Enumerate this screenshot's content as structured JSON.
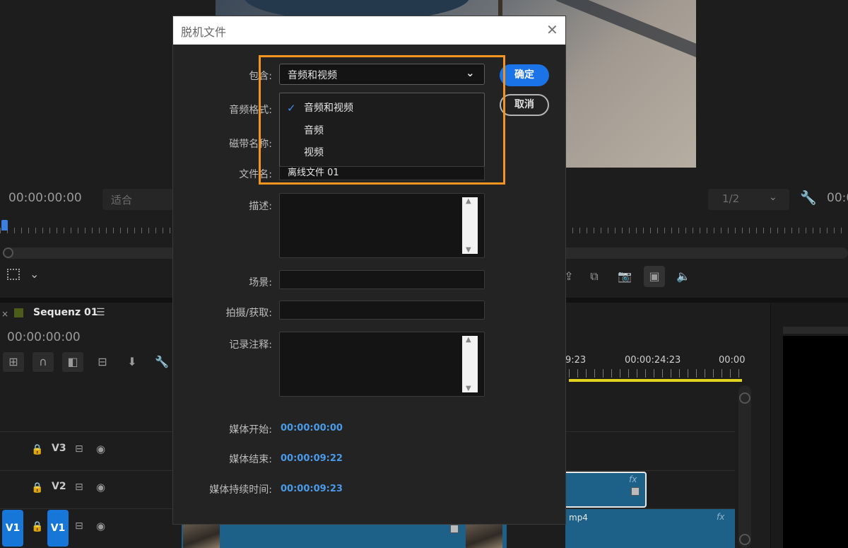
{
  "program_monitor": {
    "timecode_left": "00:00:00:00",
    "fit_label": "适合",
    "resolution": "1/2",
    "timecode_right": "00:0"
  },
  "timeline": {
    "sequence_name": "Sequenz 01",
    "timecode": "00:00:00:00",
    "ruler_labels": [
      "9:23",
      "00:00:24:23",
      "00:00"
    ],
    "tracks": [
      {
        "name": "V3"
      },
      {
        "name": "V2"
      },
      {
        "name": "V1",
        "source_patch": "V1"
      }
    ],
    "clip_v1_label": "mp4",
    "fx_label": "fx",
    "colors": {
      "clip": "#1d6189",
      "target_badge": "#1677d8",
      "work_area": "#e0d21f",
      "sequence_tag": "#4c5d1a"
    }
  },
  "dialog": {
    "title": "脱机文件",
    "close_icon": "close-icon",
    "fields": {
      "include_label": "包含:",
      "include_value": "音频和视频",
      "audio_format_label": "音频格式:",
      "tape_name_label": "磁带名称:",
      "filename_label": "文件名:",
      "filename_value": "离线文件 01",
      "description_label": "描述:",
      "scene_label": "场景:",
      "capture_label": "拍摄/获取:",
      "notes_label": "记录注释:",
      "media_start_label": "媒体开始:",
      "media_start_value": "00:00:00:00",
      "media_end_label": "媒体结束:",
      "media_end_value": "00:00:09:22",
      "media_duration_label": "媒体持续时间:",
      "media_duration_value": "00:00:09:23"
    },
    "dropdown_options": [
      {
        "label": "音频和视频",
        "selected": true
      },
      {
        "label": "音频",
        "selected": false
      },
      {
        "label": "视频",
        "selected": false
      }
    ],
    "check_icon": "✓",
    "ok_label": "确定",
    "cancel_label": "取消",
    "colors": {
      "accent": "#1b73e8",
      "highlight": "#f39420",
      "timecode": "#4b9ae8"
    }
  }
}
